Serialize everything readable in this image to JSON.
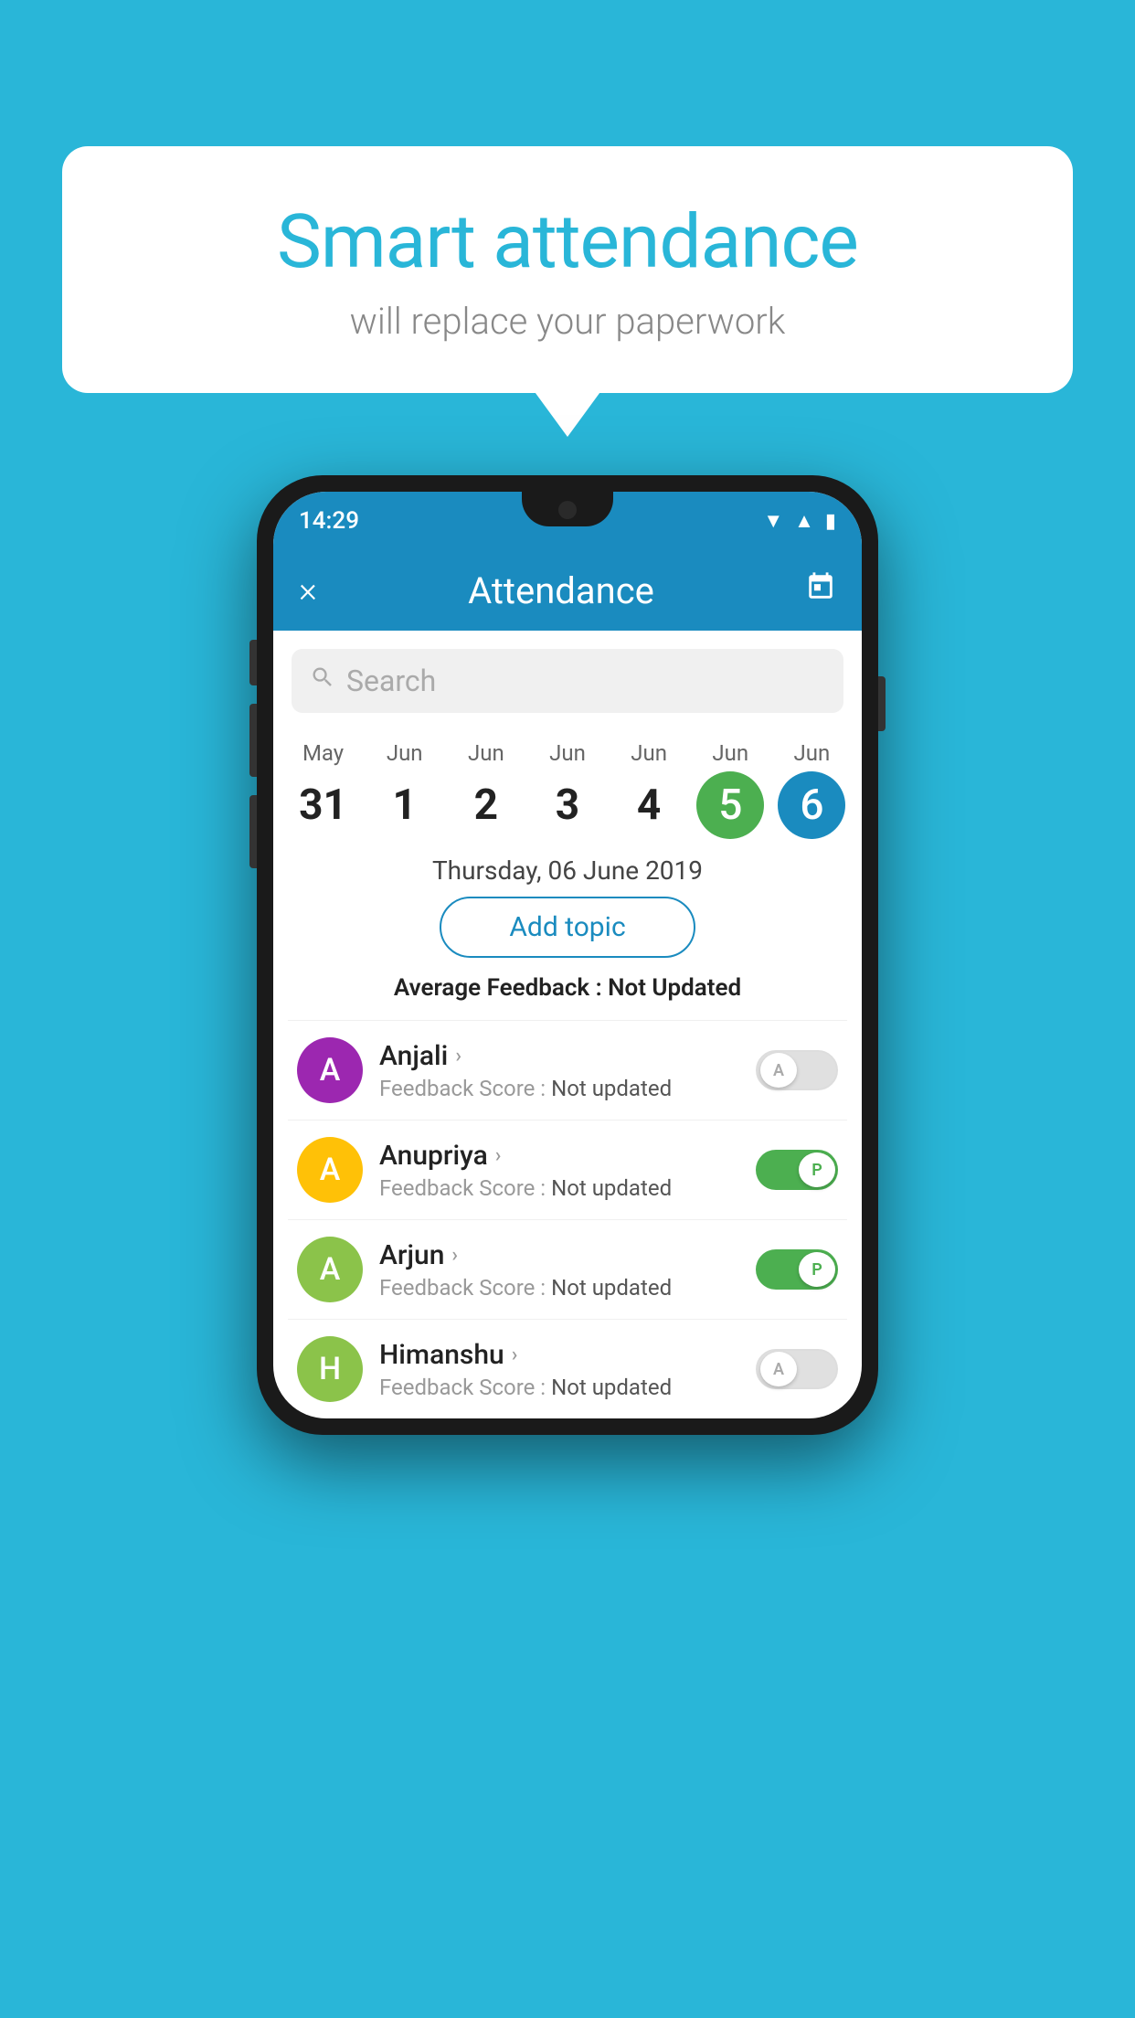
{
  "background_color": "#29b6d8",
  "bubble": {
    "title": "Smart attendance",
    "subtitle": "will replace your paperwork"
  },
  "status_bar": {
    "time": "14:29",
    "icons": [
      "wifi",
      "signal",
      "battery"
    ]
  },
  "header": {
    "close_label": "×",
    "title": "Attendance",
    "calendar_icon": "📅"
  },
  "search": {
    "placeholder": "Search"
  },
  "dates": [
    {
      "month": "May",
      "day": "31",
      "style": "normal"
    },
    {
      "month": "Jun",
      "day": "1",
      "style": "normal"
    },
    {
      "month": "Jun",
      "day": "2",
      "style": "normal"
    },
    {
      "month": "Jun",
      "day": "3",
      "style": "normal"
    },
    {
      "month": "Jun",
      "day": "4",
      "style": "normal"
    },
    {
      "month": "Jun",
      "day": "5",
      "style": "green"
    },
    {
      "month": "Jun",
      "day": "6",
      "style": "blue"
    }
  ],
  "selected_date": "Thursday, 06 June 2019",
  "add_topic_label": "Add topic",
  "avg_feedback_label": "Average Feedback : ",
  "avg_feedback_value": "Not Updated",
  "students": [
    {
      "name": "Anjali",
      "initial": "A",
      "avatar_color": "#9c27b0",
      "feedback_label": "Feedback Score : ",
      "feedback_value": "Not updated",
      "toggle": "off",
      "toggle_label": "A"
    },
    {
      "name": "Anupriya",
      "initial": "A",
      "avatar_color": "#ffc107",
      "feedback_label": "Feedback Score : ",
      "feedback_value": "Not updated",
      "toggle": "on",
      "toggle_label": "P"
    },
    {
      "name": "Arjun",
      "initial": "A",
      "avatar_color": "#8bc34a",
      "feedback_label": "Feedback Score : ",
      "feedback_value": "Not updated",
      "toggle": "on",
      "toggle_label": "P"
    },
    {
      "name": "Himanshu",
      "initial": "H",
      "avatar_color": "#8bc34a",
      "feedback_label": "Feedback Score : ",
      "feedback_value": "Not updated",
      "toggle": "off",
      "toggle_label": "A"
    }
  ]
}
